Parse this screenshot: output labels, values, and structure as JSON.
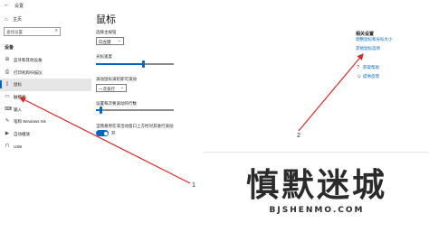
{
  "window": {
    "title": "设置",
    "back_glyph": "←"
  },
  "sidebar": {
    "home_label": "主页",
    "search_placeholder": "查找设置",
    "section_title": "设备",
    "items": [
      {
        "label": "蓝牙和其他设备",
        "icon": "bluetooth-icon",
        "glyph": "⊞"
      },
      {
        "label": "打印机和扫描仪",
        "icon": "printer-icon",
        "glyph": "⎙"
      },
      {
        "label": "鼠标",
        "icon": "mouse-icon",
        "glyph": "▯",
        "active": true
      },
      {
        "label": "触摸板",
        "icon": "touchpad-icon",
        "glyph": "▭"
      },
      {
        "label": "输入",
        "icon": "keyboard-icon",
        "glyph": "⌨"
      },
      {
        "label": "笔和 Windows Ink",
        "icon": "pen-icon",
        "glyph": "✎"
      },
      {
        "label": "自动播放",
        "icon": "autoplay-icon",
        "glyph": "▶"
      },
      {
        "label": "USB",
        "icon": "usb-icon",
        "glyph": "⊓"
      }
    ]
  },
  "main": {
    "title": "鼠标",
    "primary_button_label": "选择主按钮",
    "primary_button_value": "向左键",
    "cursor_speed_label": "光标速度",
    "cursor_speed_level": 0.62,
    "wheel_scroll_label": "滚动鼠标滚轮即可滚动",
    "wheel_scroll_value": "一次多行",
    "lines_label": "设置每次要滚动的行数",
    "lines_level": 0.05,
    "inactive_scroll_label": "当我悬停在非活动窗口上方时对其进行滚动",
    "inactive_scroll_state": "开",
    "toggle_on": true
  },
  "related": {
    "title": "相关设置",
    "links": [
      "调整鼠标和光标大小",
      "其他鼠标选项"
    ],
    "help": [
      {
        "label": "获取帮助",
        "icon": "help-icon",
        "glyph": "?"
      },
      {
        "label": "提供反馈",
        "icon": "feedback-icon",
        "glyph": "☺"
      }
    ]
  },
  "annotations": {
    "marker_1": "1",
    "marker_2": "2",
    "arrow_color": "#d42a2a"
  },
  "watermark": {
    "cn": "慎默迷城",
    "en": "BJSHENMO.COM"
  },
  "colors": {
    "accent": "#0067c0",
    "active_bg": "#e6e6e6"
  }
}
